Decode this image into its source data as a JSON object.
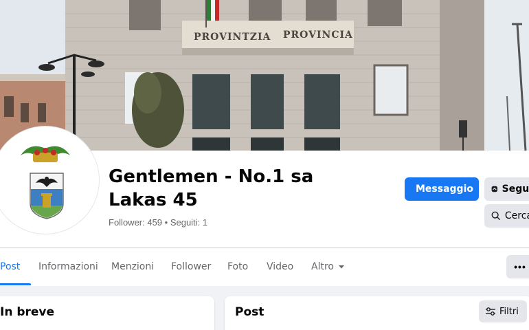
{
  "cover": {
    "banner_left": "PROVINTZIA",
    "banner_right": "PROVINCIA"
  },
  "profile": {
    "name": "Gentlemen - No.1 sa Lakas 45",
    "stats": "Follower: 459 • Seguiti: 1"
  },
  "actions": {
    "message": "Messaggio",
    "follow": "Segui",
    "search": "Cerca"
  },
  "tabs": [
    {
      "label": "Post",
      "active": true
    },
    {
      "label": "Informazioni"
    },
    {
      "label": "Menzioni"
    },
    {
      "label": "Follower"
    },
    {
      "label": "Foto"
    },
    {
      "label": "Video"
    },
    {
      "label": "Altro"
    }
  ],
  "more_button": "•••",
  "about": {
    "title": "In breve"
  },
  "posts": {
    "title": "Post",
    "filters": "Filtri"
  },
  "colors": {
    "accent": "#1877f2",
    "secondary_button": "#e4e6eb",
    "background": "#f0f2f5"
  },
  "icons": [
    "messenger-icon",
    "follow-icon",
    "search-icon",
    "caret-down-icon",
    "filters-icon",
    "coat-of-arms-icon"
  ]
}
